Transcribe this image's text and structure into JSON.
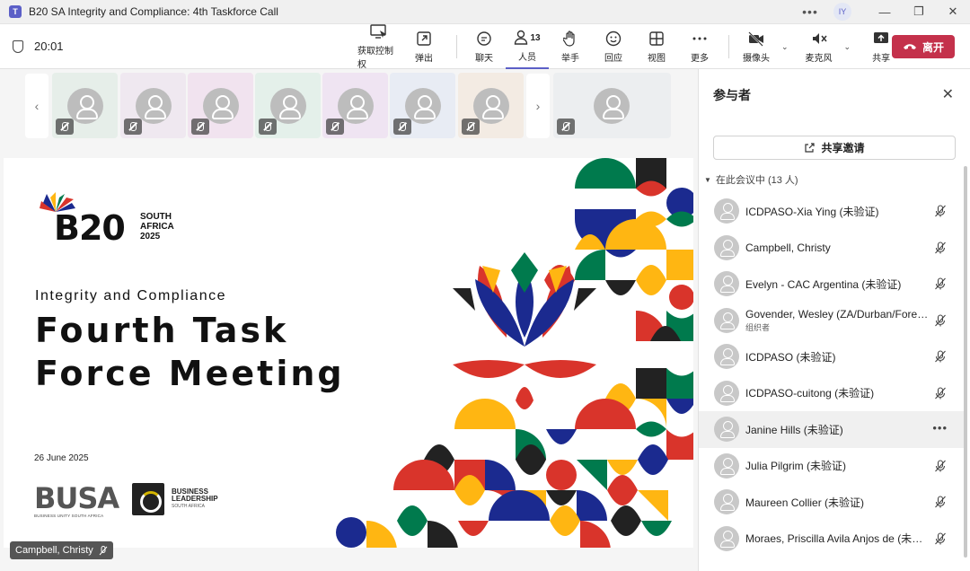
{
  "window": {
    "title": "B20 SA Integrity and Compliance: 4th Taskforce Call",
    "user_initials": "IY",
    "more": "•••",
    "minimize": "—",
    "maximize": "❐",
    "close": "✕"
  },
  "toolbar": {
    "timer": "20:01",
    "buttons": {
      "take_control": "获取控制权",
      "popout": "弹出",
      "chat": "聊天",
      "people": "人员",
      "people_count": "13",
      "raise_hand": "举手",
      "react": "回应",
      "view": "视图",
      "more": "更多",
      "camera": "摄像头",
      "mic": "麦克风",
      "share": "共享",
      "leave": "离开"
    }
  },
  "strip": {
    "prev": "‹",
    "next": "›",
    "tile_colors": [
      "#e6eee9",
      "#efe8f0",
      "#f1e3ef",
      "#e4f0ea",
      "#efe4f2",
      "#e8ecf4",
      "#f3ebe3",
      "#eceef0"
    ]
  },
  "slide": {
    "brand": "B20",
    "brand_sub": [
      "SOUTH",
      "AFRICA",
      "2025"
    ],
    "subtitle": "Integrity and Compliance",
    "headline_1": "Fourth Task",
    "headline_2": "Force Meeting",
    "date": "26 June 2025",
    "busa": "BUSA",
    "busa_sub": "BUSINESS UNITY SOUTH AFRICA",
    "bl_1": "BUSINESS",
    "bl_2": "LEADERSHIP",
    "bl_3": "SOUTH AFRICA"
  },
  "speaker_tag": "Campbell, Christy",
  "panel": {
    "title": "参与者",
    "close": "✕",
    "share_invite": "共享邀请",
    "section": "在此会议中 (13 人)",
    "participants": [
      {
        "name": "ICDPASO-Xia Ying (未验证)",
        "role": ""
      },
      {
        "name": "Campbell, Christy",
        "role": ""
      },
      {
        "name": "Evelyn - CAC Argentina (未验证)",
        "role": ""
      },
      {
        "name": "Govender, Wesley (ZA/Durban/Foren...",
        "role": "组织者"
      },
      {
        "name": "ICDPASO (未验证)",
        "role": ""
      },
      {
        "name": "ICDPASO-cuitong (未验证)",
        "role": ""
      },
      {
        "name": "Janine Hills (未验证)",
        "role": ""
      },
      {
        "name": "Julia Pilgrim (未验证)",
        "role": ""
      },
      {
        "name": "Maureen Collier (未验证)",
        "role": ""
      },
      {
        "name": "Moraes, Priscilla Avila Anjos de (未验...",
        "role": ""
      }
    ]
  }
}
